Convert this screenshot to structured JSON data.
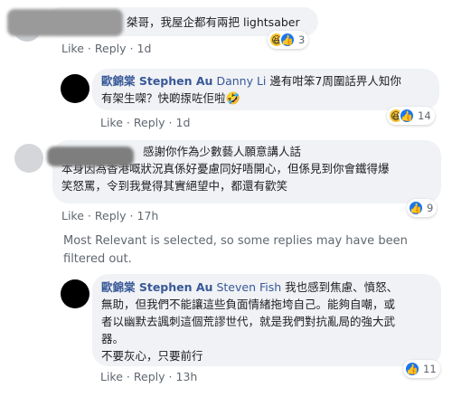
{
  "comments": [
    {
      "text": "桀哥，我屋企都有兩把 lightsaber",
      "actions": {
        "like": "Like",
        "reply": "Reply",
        "time": "1d"
      },
      "reactions": {
        "icons": [
          "haha-icon",
          "like-icon"
        ],
        "count": "3"
      }
    },
    {
      "author": "歐錦棠 Stephen Au",
      "mention": "Danny Li",
      "text_line1": " 邊有咁笨7周圍話畀人知你",
      "text_line2": "有架生㗎？快啲揼咗佢啦",
      "actions": {
        "like": "Like",
        "reply": "Reply",
        "time": "1d"
      },
      "reactions": {
        "icons": [
          "haha-icon",
          "like-icon"
        ],
        "count": "14"
      }
    },
    {
      "text_line1": "感謝你作為少數藝人願意講人話",
      "text_line2": "本身因為香港嘅狀況真係好憂慮同好唔開心，但係見到你會鐵得爆",
      "text_line3": "笑怒罵，令到我覺得其實絕望中，都還有歡笑",
      "actions": {
        "like": "Like",
        "reply": "Reply",
        "time": "17h"
      },
      "reactions": {
        "icons": [
          "like-icon"
        ],
        "count": "9"
      }
    },
    {
      "author": "歐錦棠 Stephen Au",
      "mention": "Steven Fish",
      "text_line1": " 我也感到焦慮、憤怒、",
      "text_line2": "無助，但我們不能讓這些負面情緒拖垮自己。能夠自嘲，或",
      "text_line3": "者以幽默去諷刺這個荒謬世代，就是我們對抗亂局的強大武",
      "text_line4": "器。",
      "text_line5": "不要灰心，只要前行",
      "actions": {
        "like": "Like",
        "reply": "Reply",
        "time": "13h"
      },
      "reactions": {
        "icons": [
          "like-icon"
        ],
        "count": "11"
      }
    }
  ],
  "filter_note": "Most Relevant is selected, so some replies may have been filtered out."
}
